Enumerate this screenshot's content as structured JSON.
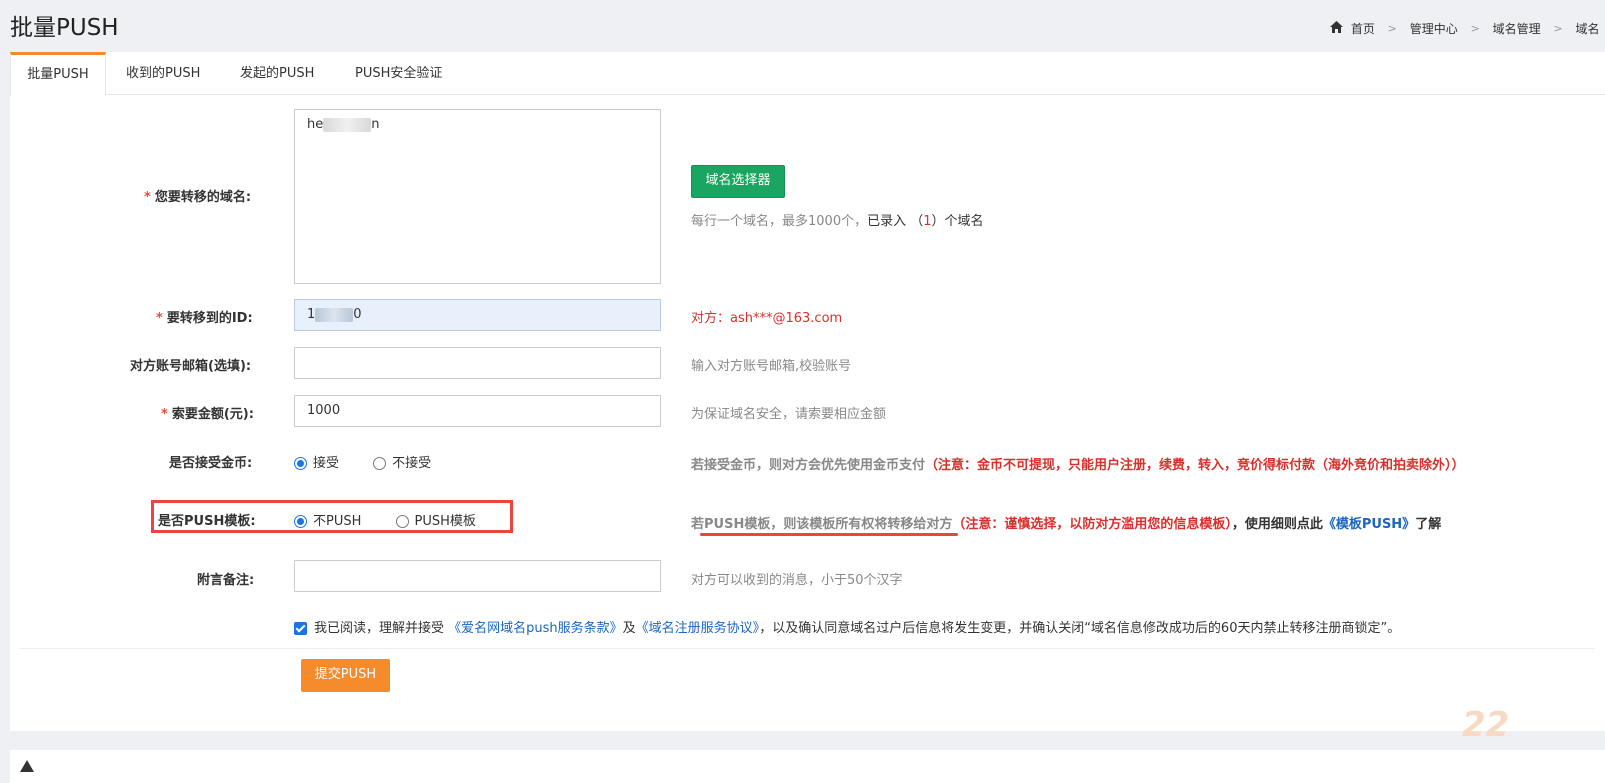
{
  "page": {
    "title": "批量PUSH"
  },
  "breadcrumb": {
    "home": "首页",
    "items": [
      "管理中心",
      "域名管理",
      "域名"
    ],
    "sep": ">"
  },
  "tabs": [
    {
      "label": "批量PUSH",
      "active": true
    },
    {
      "label": "收到的PUSH",
      "active": false
    },
    {
      "label": "发起的PUSH",
      "active": false
    },
    {
      "label": "PUSH安全验证",
      "active": false
    }
  ],
  "form": {
    "domains": {
      "label": "您要转移的域名:",
      "required": "*",
      "value_start": "he",
      "value_end": "n",
      "selector_button": "域名选择器",
      "hint_prefix": "每行一个域名，最多1000个，",
      "hint_entered": "已录入 （",
      "hint_count": "1",
      "hint_suffix": "）个域名"
    },
    "target_id": {
      "label": "要转移到的ID:",
      "required": "*",
      "value_start": "1",
      "value_end": "0",
      "hint": "对方：ash***@163.com"
    },
    "email": {
      "label": "对方账号邮箱(选填):",
      "value": "",
      "hint": "输入对方账号邮箱,校验账号"
    },
    "amount": {
      "label": "索要金额(元):",
      "required": "*",
      "value": "1000",
      "hint": "为保证域名安全，请索要相应金额"
    },
    "gold": {
      "label": "是否接受金币:",
      "options": [
        "接受",
        "不接受"
      ],
      "selected": 0,
      "hint_gray": "若接受金币，则对方会优先使用金币支付",
      "hint_red": "（注意：金币不可提现，只能用户注册，续费，转入，竞价得标付款（海外竞价和拍卖除外））"
    },
    "push_template": {
      "label": "是否PUSH模板:",
      "options": [
        "不PUSH",
        "PUSH模板"
      ],
      "selected": 0,
      "hint_gray": "若PUSH模板，则该模板所有权将转移给对方",
      "hint_red": "（注意：谨慎选择，以防对方滥用您的信息模板）",
      "hint_black": "，使用细则点此",
      "hint_link": "《模板PUSH》",
      "hint_end": "了解"
    },
    "note": {
      "label": "附言备注:",
      "value": "",
      "hint": "对方可以收到的消息，小于50个汉字"
    },
    "agreement": {
      "checked": true,
      "prefix": "我已阅读，理解并接受 ",
      "link1": "《爱名网域名push服务条款》",
      "mid": "及",
      "link2": "《域名注册服务协议》",
      "suffix": "，以及确认同意域名过户后信息将发生变更，并确认关闭“域名信息修改成功后的60天内禁止转移注册商锁定”。"
    },
    "submit": "提交PUSH"
  },
  "watermark": "22",
  "colors": {
    "accent": "#f68b2b",
    "green": "#1aa560",
    "red": "#d9302c",
    "link": "#1a66c2",
    "highlight": "#e8473f"
  }
}
